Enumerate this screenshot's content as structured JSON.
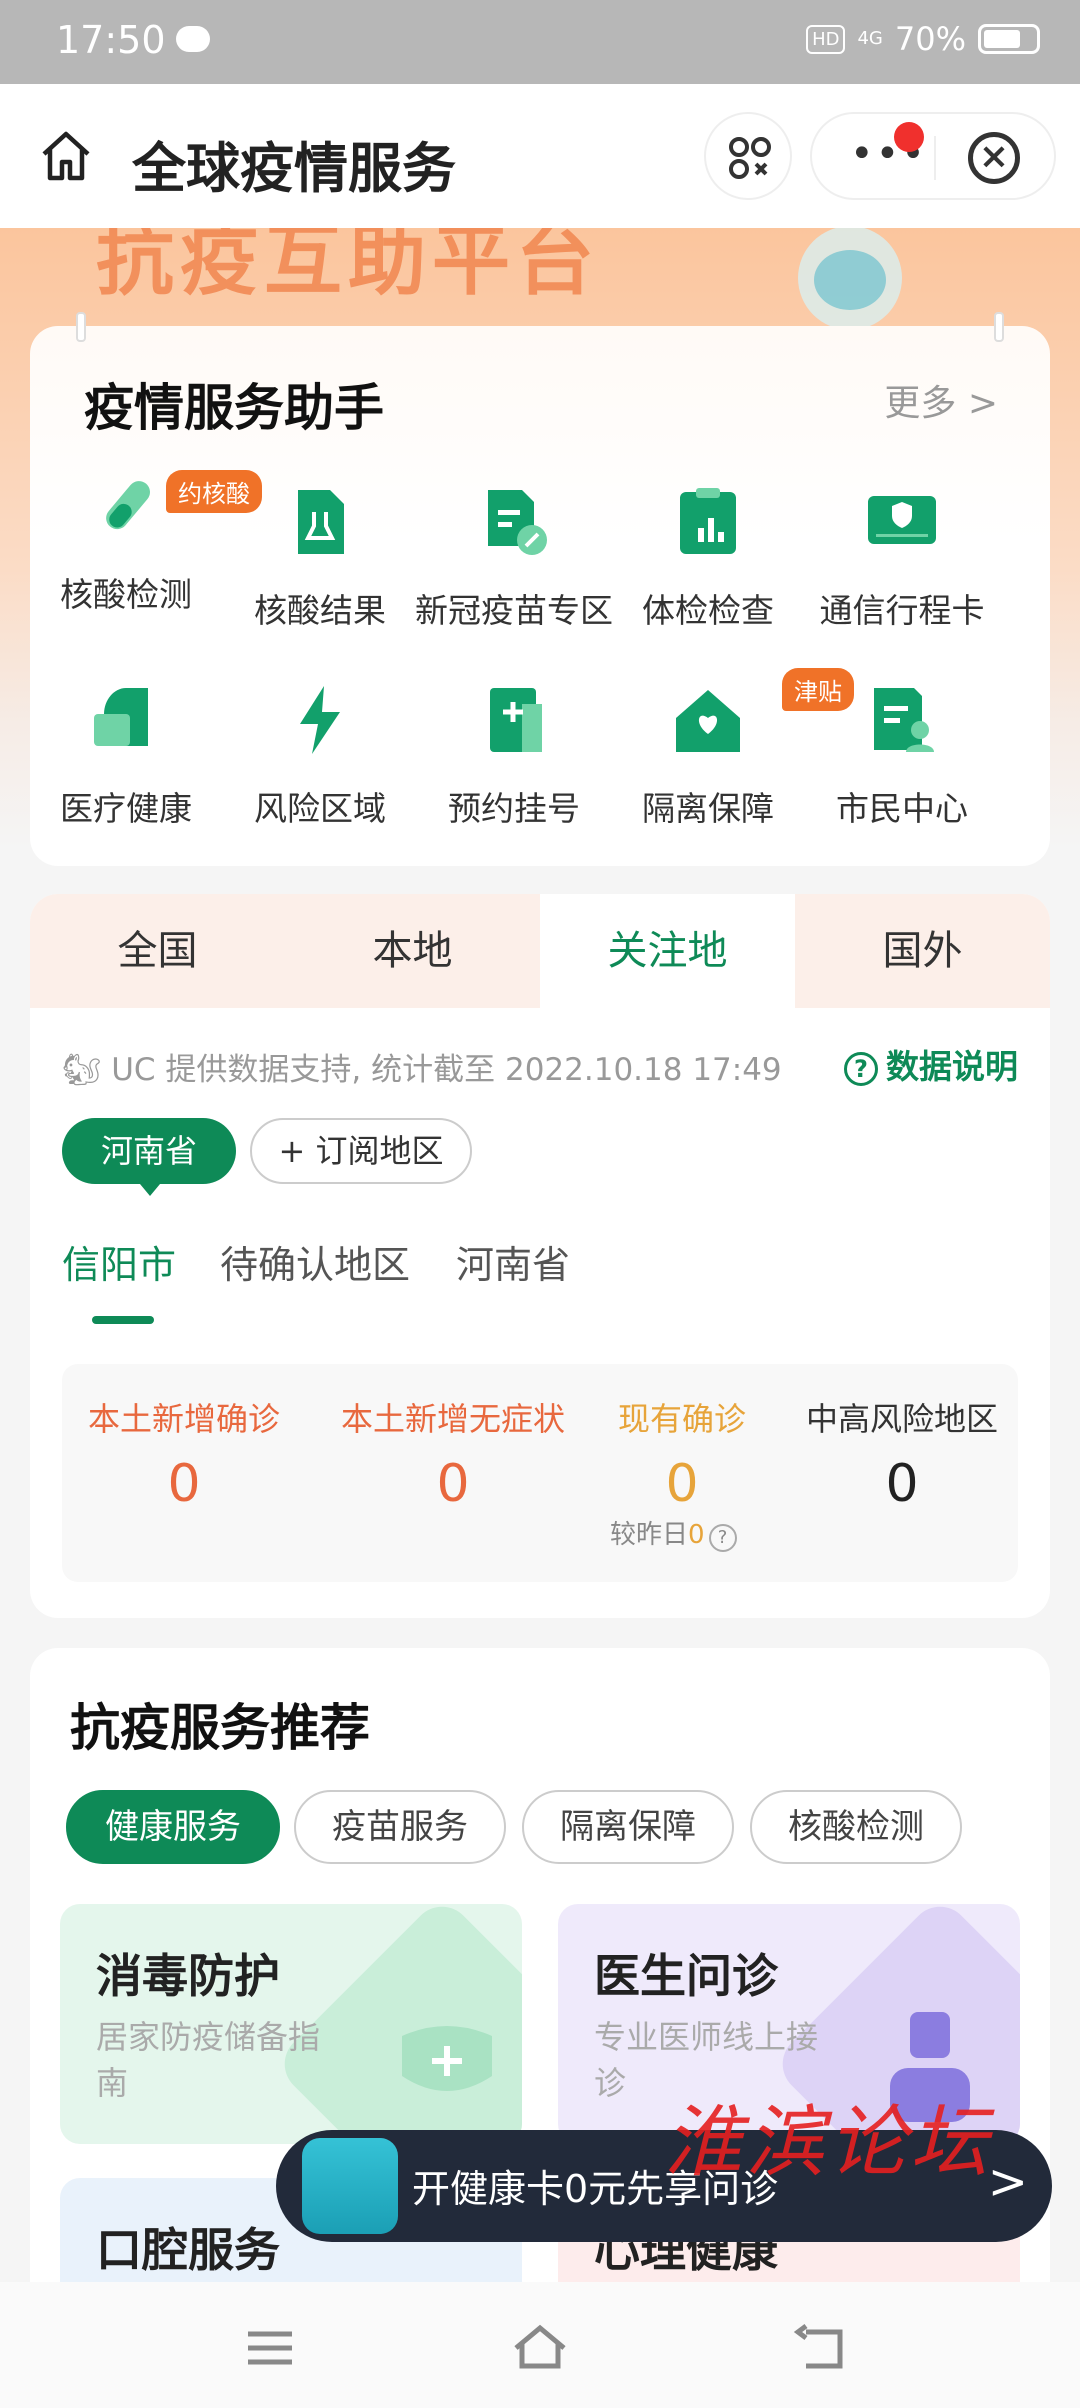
{
  "status_bar": {
    "time": "17:50",
    "network_hd": "HD",
    "network_gen": "4G",
    "battery": "70%"
  },
  "nav": {
    "title": "全球疫情服务"
  },
  "banner": {
    "text": "抗疫互助平台"
  },
  "services": {
    "title": "疫情服务助手",
    "more": "更多",
    "items": [
      {
        "label": "核酸检测",
        "icon": "test-tube-icon",
        "tag": "约核酸"
      },
      {
        "label": "核酸结果",
        "icon": "result-document-icon"
      },
      {
        "label": "新冠疫苗专区",
        "icon": "vaccine-document-icon"
      },
      {
        "label": "体检检查",
        "icon": "clipboard-chart-icon"
      },
      {
        "label": "通信行程卡",
        "icon": "shield-card-icon"
      },
      {
        "label": "医疗健康",
        "icon": "heart-cross-icon"
      },
      {
        "label": "风险区域",
        "icon": "lightning-icon"
      },
      {
        "label": "预约挂号",
        "icon": "medical-card-icon"
      },
      {
        "label": "隔离保障",
        "icon": "house-plus-icon",
        "tag": "津贴"
      },
      {
        "label": "市民中心",
        "icon": "citizen-card-icon"
      }
    ]
  },
  "data": {
    "tabs": [
      "全国",
      "本地",
      "关注地",
      "国外"
    ],
    "active_tab": 2,
    "source_text": "UC 提供数据支持, 统计截至 2022.10.18 17:49",
    "explain": "数据说明",
    "region_chip": "河南省",
    "subscribe": "+ 订阅地区",
    "subtabs": [
      "信阳市",
      "待确认地区",
      "河南省"
    ],
    "stats": [
      {
        "label": "本土新增确诊",
        "value": "0",
        "color": "#e8683e"
      },
      {
        "label": "本土新增无症状",
        "value": "0",
        "color": "#e8683e"
      },
      {
        "label": "现有确诊",
        "value": "0",
        "color": "#e7a43a"
      },
      {
        "label": "中高风险地区",
        "value": "0",
        "color": "#222222"
      }
    ],
    "compare_label": "较昨日",
    "compare_value": "0"
  },
  "recommend": {
    "title": "抗疫服务推荐",
    "pills": [
      "健康服务",
      "疫苗服务",
      "隔离保障",
      "核酸检测"
    ],
    "tiles": [
      {
        "title": "消毒防护",
        "desc": "居家防疫储备指南"
      },
      {
        "title": "医生问诊",
        "desc": "专业医师线上接诊"
      },
      {
        "title": "口腔服务",
        "desc": ""
      },
      {
        "title": "心理健康",
        "desc": ""
      }
    ]
  },
  "promo": {
    "text": "开健康卡0元先享问诊"
  },
  "watermark": "淮滨论坛"
}
